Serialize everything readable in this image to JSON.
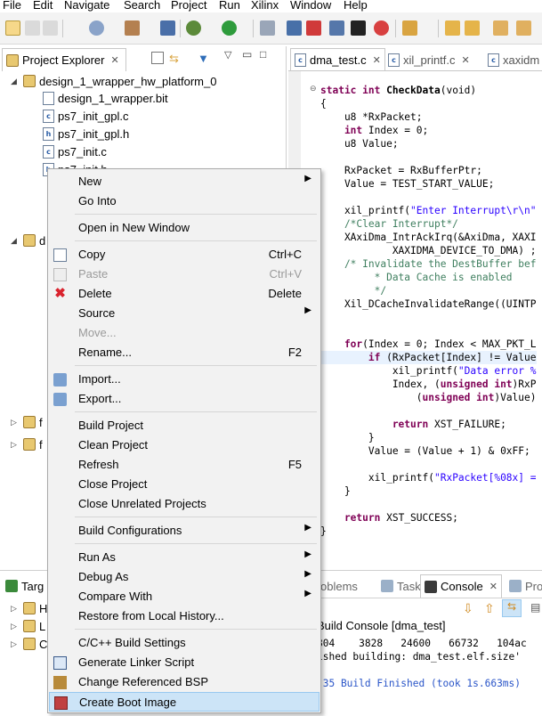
{
  "menubar": [
    "File",
    "Edit",
    "Navigate",
    "Search",
    "Project",
    "Run",
    "Xilinx",
    "Window",
    "Help"
  ],
  "project_explorer": {
    "title": "Project Explorer",
    "items": [
      {
        "label": "design_1_wrapper_hw_platform_0",
        "type": "folder",
        "expanded": true
      },
      {
        "label": "design_1_wrapper.bit",
        "type": "file"
      },
      {
        "label": "ps7_init_gpl.c",
        "type": "c"
      },
      {
        "label": "ps7_init_gpl.h",
        "type": "h"
      },
      {
        "label": "ps7_init.c",
        "type": "c"
      },
      {
        "label": "ps7_init.h",
        "type": "h"
      }
    ],
    "partial_items": [
      "d",
      "f",
      "f"
    ]
  },
  "editor_tabs": [
    {
      "label": "dma_test.c",
      "active": true
    },
    {
      "label": "xil_printf.c",
      "active": false
    },
    {
      "label": "xaxidm",
      "active": false
    }
  ],
  "code_lines": [
    [
      [
        "kw",
        "static int "
      ],
      [
        "b",
        "CheckData"
      ],
      [
        "",
        "(void)"
      ]
    ],
    [
      [
        "",
        "{"
      ]
    ],
    [
      [
        "",
        "    u8 *RxPacket;"
      ]
    ],
    [
      [
        "kw",
        "    int "
      ],
      [
        "",
        "Index = 0;"
      ]
    ],
    [
      [
        "",
        "    u8 Value;"
      ]
    ],
    [
      [
        "",
        ""
      ]
    ],
    [
      [
        "",
        "    RxPacket = RxBufferPtr;"
      ]
    ],
    [
      [
        "",
        "    Value = TEST_START_VALUE;"
      ]
    ],
    [
      [
        "",
        ""
      ]
    ],
    [
      [
        "",
        "    xil_printf("
      ],
      [
        "str",
        "\"Enter Interrupt\\r\\n\""
      ]
    ],
    [
      [
        "cm",
        "    /*Clear Interrupt*/"
      ]
    ],
    [
      [
        "",
        "    XAxiDma_IntrAckIrq(&AxiDma, XAXI"
      ]
    ],
    [
      [
        "",
        "            XAXIDMA_DEVICE_TO_DMA) ;"
      ]
    ],
    [
      [
        "cm",
        "    /* Invalidate the DestBuffer bef"
      ]
    ],
    [
      [
        "cm",
        "         * Data Cache is enabled"
      ]
    ],
    [
      [
        "cm",
        "         */"
      ]
    ],
    [
      [
        "",
        "    Xil_DCacheInvalidateRange((UINTP"
      ]
    ],
    [
      [
        "",
        ""
      ]
    ],
    [
      [
        "",
        ""
      ]
    ],
    [
      [
        "kw",
        "    for"
      ],
      [
        "",
        "(Index = 0; Index < MAX_PKT_L"
      ]
    ],
    [
      [
        "kw",
        "        if "
      ],
      [
        "",
        "(RxPacket[Index] != Value"
      ]
    ],
    [
      [
        "",
        "            xil_printf("
      ],
      [
        "str",
        "\"Data error %"
      ]
    ],
    [
      [
        "",
        "            Index, ("
      ],
      [
        "kw",
        "unsigned int"
      ],
      [
        "",
        ")RxP"
      ]
    ],
    [
      [
        "",
        "                ("
      ],
      [
        "kw",
        "unsigned int"
      ],
      [
        "",
        ")Value)"
      ]
    ],
    [
      [
        "",
        ""
      ]
    ],
    [
      [
        "kw",
        "            return "
      ],
      [
        "",
        "XST_FAILURE;"
      ]
    ],
    [
      [
        "",
        "        }"
      ]
    ],
    [
      [
        "",
        "        Value = (Value + 1) & 0xFF;"
      ]
    ],
    [
      [
        "",
        ""
      ]
    ],
    [
      [
        "",
        "        xil_printf("
      ],
      [
        "str",
        "\"RxPacket[%08x] ="
      ]
    ],
    [
      [
        "",
        "    }"
      ]
    ],
    [
      [
        "",
        ""
      ]
    ],
    [
      [
        "kw",
        "    return "
      ],
      [
        "",
        "XST_SUCCESS;"
      ]
    ],
    [
      [
        "",
        "}"
      ]
    ]
  ],
  "bottom_left_tab": "Targ",
  "bottom_left_partial": [
    "H",
    "L",
    "C"
  ],
  "console": {
    "tabs": [
      "oblems",
      "Tasks",
      "Console",
      "Pro"
    ],
    "active_tab": "Console",
    "header": "Build Console [dma_test]",
    "lines": [
      "804    3828   24600   66732   104ac",
      "ished building: dma_test.elf.size'",
      "",
      ":35 Build Finished (took 1s.663ms)"
    ]
  },
  "context_menu": [
    {
      "label": "New",
      "key": "",
      "submenu": true,
      "icon": "",
      "disabled": false
    },
    {
      "label": "Go Into",
      "key": "",
      "submenu": false,
      "icon": "",
      "disabled": false
    },
    {
      "sep": true
    },
    {
      "label": "Open in New Window",
      "key": "",
      "submenu": false,
      "icon": "",
      "disabled": false
    },
    {
      "sep": true
    },
    {
      "label": "Copy",
      "key": "Ctrl+C",
      "submenu": false,
      "icon": "copy-icon",
      "disabled": false
    },
    {
      "label": "Paste",
      "key": "Ctrl+V",
      "submenu": false,
      "icon": "paste-icon",
      "disabled": true
    },
    {
      "label": "Delete",
      "key": "Delete",
      "submenu": false,
      "icon": "delete-icon",
      "disabled": false
    },
    {
      "label": "Source",
      "key": "",
      "submenu": true,
      "icon": "",
      "disabled": false
    },
    {
      "label": "Move...",
      "key": "",
      "submenu": false,
      "icon": "",
      "disabled": true
    },
    {
      "label": "Rename...",
      "key": "F2",
      "submenu": false,
      "icon": "",
      "disabled": false
    },
    {
      "sep": true
    },
    {
      "label": "Import...",
      "key": "",
      "submenu": false,
      "icon": "import-icon",
      "disabled": false
    },
    {
      "label": "Export...",
      "key": "",
      "submenu": false,
      "icon": "export-icon",
      "disabled": false
    },
    {
      "sep": true
    },
    {
      "label": "Build Project",
      "key": "",
      "submenu": false,
      "icon": "",
      "disabled": false
    },
    {
      "label": "Clean Project",
      "key": "",
      "submenu": false,
      "icon": "",
      "disabled": false
    },
    {
      "label": "Refresh",
      "key": "F5",
      "submenu": false,
      "icon": "",
      "disabled": false
    },
    {
      "label": "Close Project",
      "key": "",
      "submenu": false,
      "icon": "",
      "disabled": false
    },
    {
      "label": "Close Unrelated Projects",
      "key": "",
      "submenu": false,
      "icon": "",
      "disabled": false
    },
    {
      "sep": true
    },
    {
      "label": "Build Configurations",
      "key": "",
      "submenu": true,
      "icon": "",
      "disabled": false
    },
    {
      "sep": true
    },
    {
      "label": "Run As",
      "key": "",
      "submenu": true,
      "icon": "",
      "disabled": false
    },
    {
      "label": "Debug As",
      "key": "",
      "submenu": true,
      "icon": "",
      "disabled": false
    },
    {
      "label": "Compare With",
      "key": "",
      "submenu": true,
      "icon": "",
      "disabled": false
    },
    {
      "label": "Restore from Local History...",
      "key": "",
      "submenu": false,
      "icon": "",
      "disabled": false
    },
    {
      "sep": true
    },
    {
      "label": "C/C++ Build Settings",
      "key": "",
      "submenu": false,
      "icon": "",
      "disabled": false
    },
    {
      "label": "Generate Linker Script",
      "key": "",
      "submenu": false,
      "icon": "linker-script-icon",
      "disabled": false
    },
    {
      "label": "Change Referenced BSP",
      "key": "",
      "submenu": false,
      "icon": "bsp-icon",
      "disabled": false
    },
    {
      "label": "Create Boot Image",
      "key": "",
      "submenu": false,
      "icon": "boot-image-icon",
      "disabled": false,
      "highlighted": true
    }
  ],
  "colors": {
    "keyword": "#7f0055",
    "comment": "#3f7f5f",
    "string": "#2a00ff",
    "menu_highlight": "#cce4f7",
    "delete_red": "#d9232e"
  }
}
